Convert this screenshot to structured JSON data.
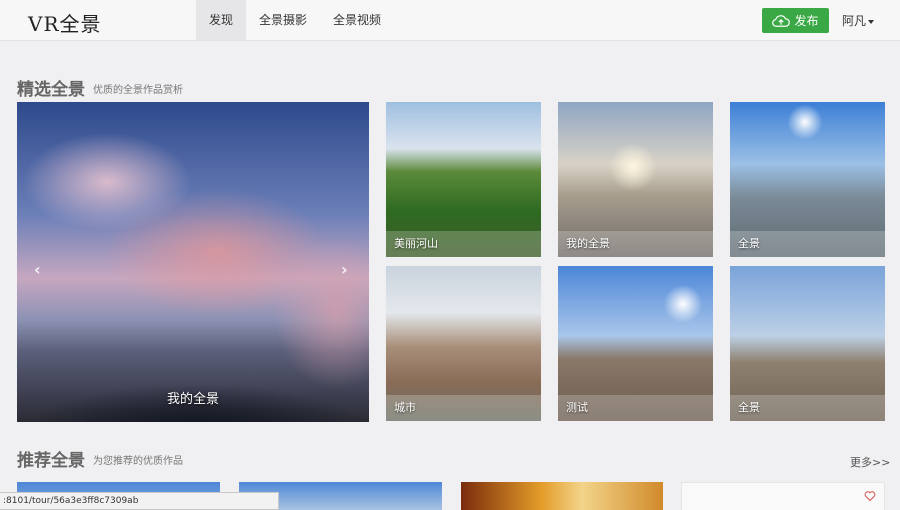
{
  "header": {
    "logo": "VR全景",
    "nav": [
      {
        "label": "发现",
        "active": true
      },
      {
        "label": "全景摄影",
        "active": false
      },
      {
        "label": "全景视频",
        "active": false
      }
    ],
    "publish_label": "发布",
    "user_name": "阿凡",
    "colors": {
      "publish_bg": "#3aa844",
      "active_nav_bg": "#e6e6e8"
    }
  },
  "featured": {
    "title": "精选全景",
    "subtitle": "优质的全景作品赏析",
    "hero": {
      "caption": "我的全景",
      "prev_icon": "chevron-left-icon",
      "next_icon": "chevron-right-icon"
    },
    "tiles": [
      {
        "caption": "美丽河山"
      },
      {
        "caption": "我的全景"
      },
      {
        "caption": "全景"
      },
      {
        "caption": "城市"
      },
      {
        "caption": "测试"
      },
      {
        "caption": "全景"
      }
    ]
  },
  "recommended": {
    "title": "推荐全景",
    "subtitle": "为您推荐的优质作品",
    "more_label": "更多>>"
  },
  "status_bar": {
    "url": ":8101/tour/56a3e3ff8c7309ab"
  }
}
